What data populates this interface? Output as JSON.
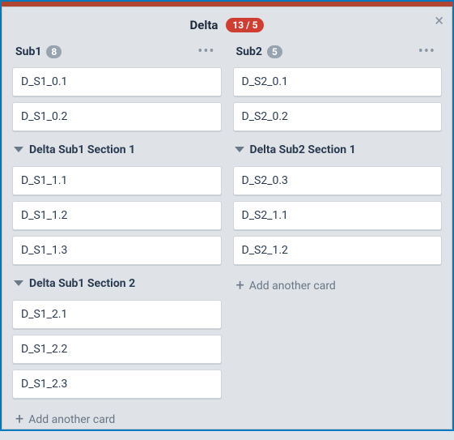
{
  "header": {
    "title": "Delta",
    "badge": "13 / 5",
    "close": "×"
  },
  "lists": [
    {
      "title": "Sub1",
      "count": "8",
      "items": [
        {
          "type": "card",
          "text": "D_S1_0.1"
        },
        {
          "type": "card",
          "text": "D_S1_0.2"
        },
        {
          "type": "section",
          "text": "Delta Sub1 Section 1"
        },
        {
          "type": "card",
          "text": "D_S1_1.1"
        },
        {
          "type": "card",
          "text": "D_S1_1.2"
        },
        {
          "type": "card",
          "text": "D_S1_1.3"
        },
        {
          "type": "section",
          "text": "Delta Sub1 Section 2"
        },
        {
          "type": "card",
          "text": "D_S1_2.1"
        },
        {
          "type": "card",
          "text": "D_S1_2.2"
        },
        {
          "type": "card",
          "text": "D_S1_2.3"
        }
      ],
      "add_label": "Add another card"
    },
    {
      "title": "Sub2",
      "count": "5",
      "items": [
        {
          "type": "card",
          "text": "D_S2_0.1"
        },
        {
          "type": "card",
          "text": "D_S2_0.2"
        },
        {
          "type": "section",
          "text": "Delta Sub2 Section 1"
        },
        {
          "type": "card",
          "text": "D_S2_0.3"
        },
        {
          "type": "card",
          "text": "D_S2_1.1"
        },
        {
          "type": "card",
          "text": "D_S2_1.2"
        }
      ],
      "add_label": "Add another card"
    }
  ],
  "menu_dots": "•••"
}
